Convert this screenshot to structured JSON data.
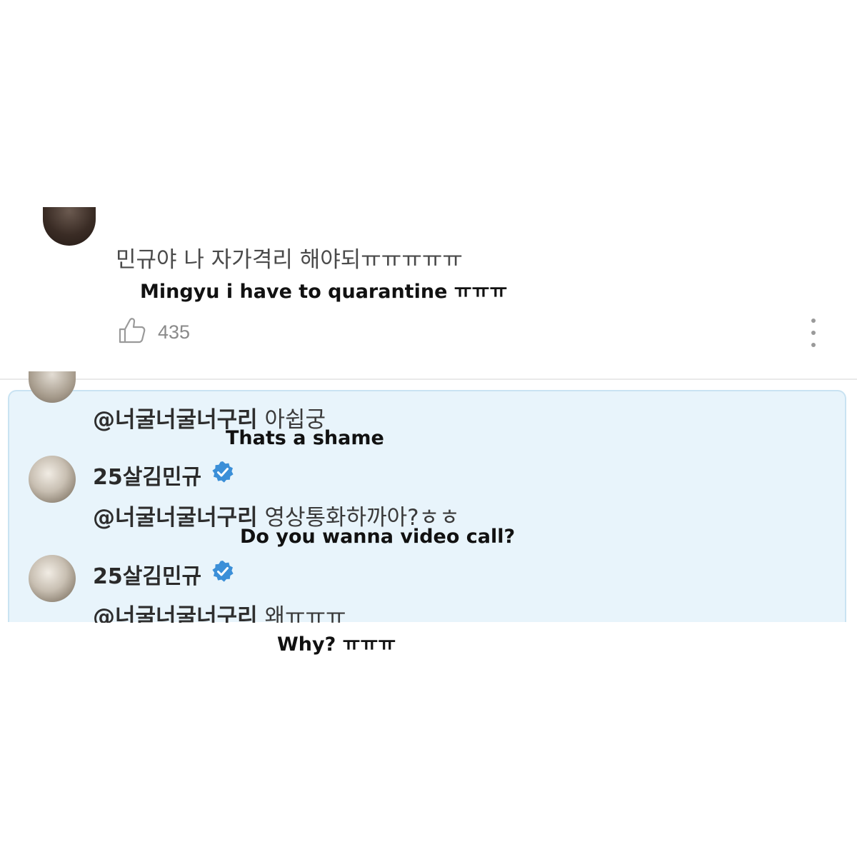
{
  "top_comment": {
    "text": "민규야 나 자가격리 해야되ㅠㅠㅠㅠㅠ",
    "translation": "Mingyu i have to quarantine ㅠㅠㅠ",
    "like_count": "435",
    "like_icon": "thumbs-up-icon",
    "more_icon": "more-vertical-icon"
  },
  "replies": [
    {
      "mention": "@너굴너굴너구리",
      "text": "아쉽궁",
      "translation": "Thats a shame"
    },
    {
      "username": "25살김민규",
      "mention": "@너굴너굴너구리",
      "text": "영상통화하까아?ㅎㅎ",
      "translation": "Do you wanna video call?"
    },
    {
      "username": "25살김민규",
      "mention": "@너굴너굴너구리",
      "text": "왜ㅠㅠㅠ",
      "translation": "Why? ㅠㅠㅠ"
    }
  ],
  "colors": {
    "panel_background": "#e8f4fb",
    "panel_border": "#c9e3f2",
    "verified_badge": "#3b8fd8"
  }
}
